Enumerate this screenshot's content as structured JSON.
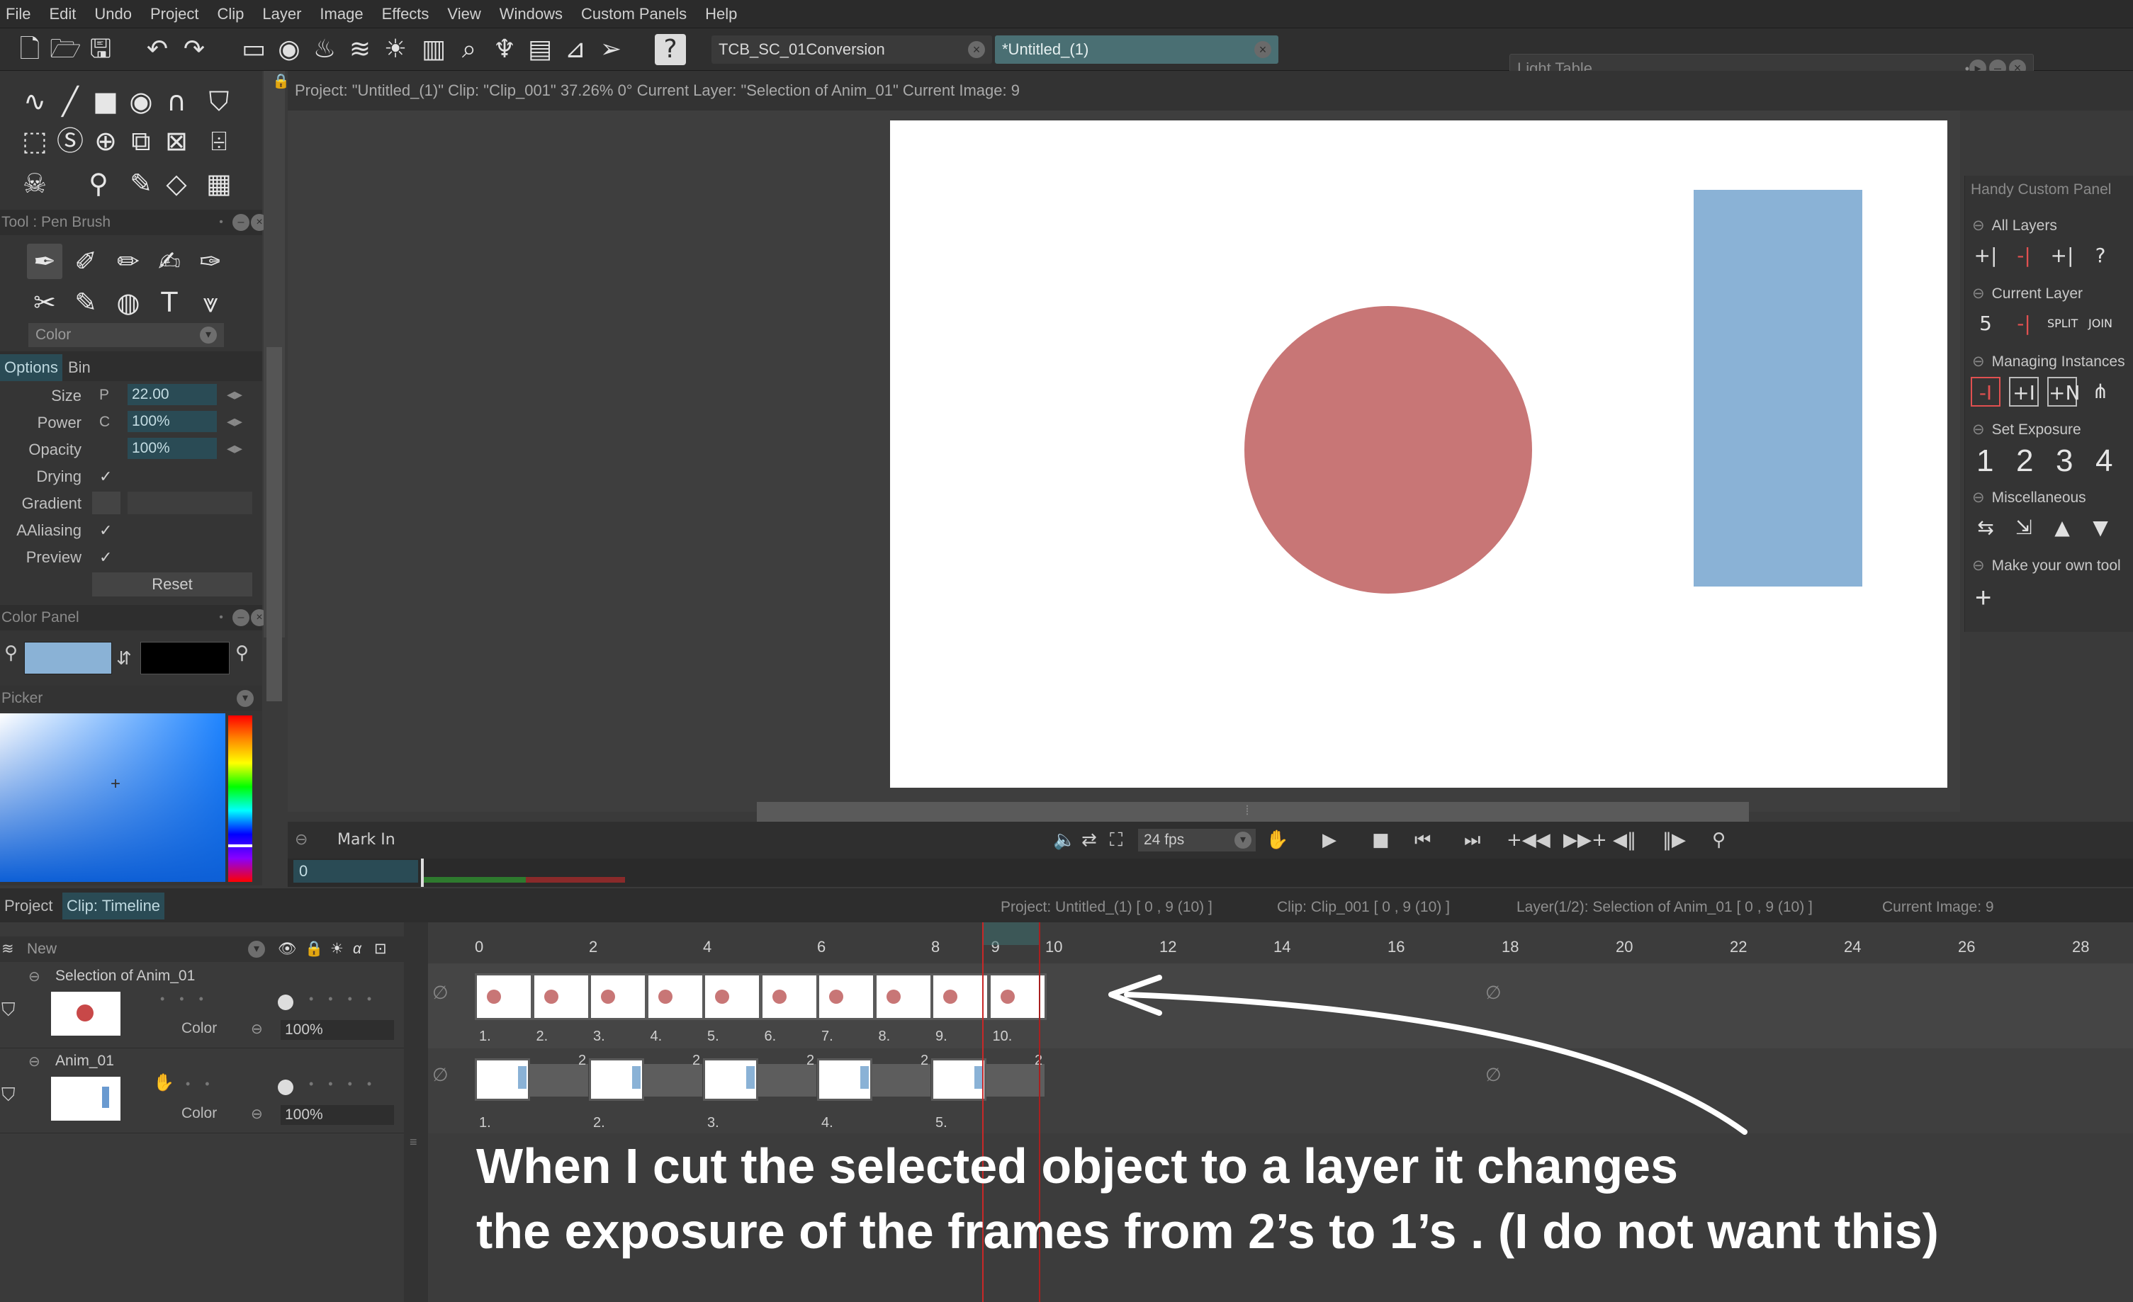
{
  "colors": {
    "accent_teal": "#2a4b55",
    "circle": "#c87676",
    "rect": "#8ab2d6",
    "arrow": "#ffffff",
    "playhead": "#c82828"
  },
  "menu": [
    "File",
    "Edit",
    "Undo",
    "Project",
    "Clip",
    "Layer",
    "Image",
    "Effects",
    "View",
    "Windows",
    "Custom Panels",
    "Help"
  ],
  "toolbar": {
    "tabs": [
      "TCB_SC_01Conversion",
      "*Untitled_(1)"
    ],
    "light_table": "Light Table"
  },
  "status_info": "Project: \"Untitled_(1)\" Clip: \"Clip_001\" 37.26% 0° Current Layer: \"Selection of Anim_01\" Current Image: 9",
  "tool_panel": {
    "title": "Tool : Pen Brush",
    "color_dropdown": "Color",
    "tabs": [
      "Options",
      "Bin"
    ],
    "options": [
      {
        "label": "Size",
        "prefix": "P",
        "value": "22.00"
      },
      {
        "label": "Power",
        "prefix": "C",
        "value": "100%"
      },
      {
        "label": "Opacity",
        "prefix": "",
        "value": "100%"
      }
    ],
    "checks": [
      "Drying",
      "Gradient",
      "AAliasing",
      "Preview"
    ],
    "reset": "Reset"
  },
  "color_panel": {
    "title": "Color Panel",
    "picker": "Picker"
  },
  "handy_panel": {
    "title": "Handy Custom Panel",
    "sections": [
      "All Layers",
      "Current Layer",
      "Managing Instances",
      "Set Exposure",
      "Miscellaneous",
      "Make your own tool"
    ],
    "exposure_numbers": [
      "1",
      "2",
      "3",
      "4"
    ],
    "add": "+"
  },
  "playback": {
    "mark_in": "Mark In",
    "fps": "24 fps",
    "frame": "0"
  },
  "timeline": {
    "tabs": [
      "Project",
      "Clip: Timeline"
    ],
    "summary": [
      "Project: Untitled_(1) [ 0 , 9 (10) ]",
      "Clip: Clip_001 [ 0 , 9 (10) ]",
      "Layer(1/2): Selection of Anim_01 [ 0 , 9 (10) ]",
      "Current Image: 9"
    ],
    "new_label": "New",
    "ruler": [
      "0",
      "2",
      "4",
      "6",
      "8",
      "9",
      "10",
      "12",
      "14",
      "16",
      "18",
      "20",
      "22",
      "24",
      "26",
      "28"
    ],
    "layers": [
      {
        "name": "Selection of Anim_01",
        "blend": "Color",
        "opacity": "100%",
        "cels": [
          "1.",
          "2.",
          "3.",
          "4.",
          "5.",
          "6.",
          "7.",
          "8.",
          "9.",
          "10."
        ]
      },
      {
        "name": "Anim_01",
        "blend": "Color",
        "opacity": "100%",
        "cels": [
          "1.",
          "2.",
          "3.",
          "4.",
          "5."
        ],
        "hold_marks": [
          "2",
          "2",
          "2",
          "2",
          "2"
        ]
      }
    ]
  },
  "caption": [
    "When I cut the selected object to a layer it changes",
    "the exposure of the frames from 2’s to 1’s . (I do not want this)"
  ]
}
